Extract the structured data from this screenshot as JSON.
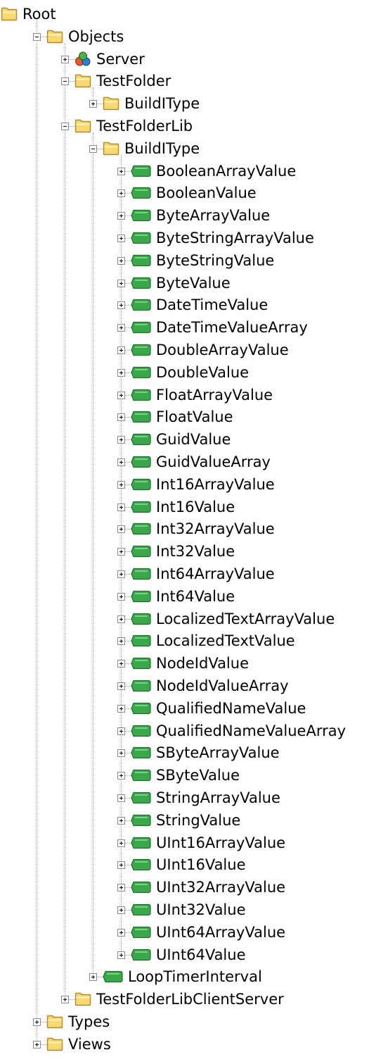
{
  "tree": {
    "label": "Root",
    "icon": "folder-icon",
    "expanded": true,
    "children": [
      {
        "label": "Objects",
        "icon": "folder-icon",
        "expanded": true,
        "children": [
          {
            "label": "Server",
            "icon": "server-icon",
            "expanded": false
          },
          {
            "label": "TestFolder",
            "icon": "folder-icon",
            "expanded": true,
            "children": [
              {
                "label": "BuildIType",
                "icon": "folder-icon",
                "expanded": false
              }
            ]
          },
          {
            "label": "TestFolderLib",
            "icon": "folder-icon",
            "expanded": true,
            "children": [
              {
                "label": "BuildIType",
                "icon": "folder-icon",
                "expanded": true,
                "children": [
                  {
                    "label": "BooleanArrayValue",
                    "icon": "variable-tag-icon",
                    "expanded": false
                  },
                  {
                    "label": "BooleanValue",
                    "icon": "variable-tag-icon",
                    "expanded": false
                  },
                  {
                    "label": "ByteArrayValue",
                    "icon": "variable-tag-icon",
                    "expanded": false
                  },
                  {
                    "label": "ByteStringArrayValue",
                    "icon": "variable-tag-icon",
                    "expanded": false
                  },
                  {
                    "label": "ByteStringValue",
                    "icon": "variable-tag-icon",
                    "expanded": false
                  },
                  {
                    "label": "ByteValue",
                    "icon": "variable-tag-icon",
                    "expanded": false
                  },
                  {
                    "label": "DateTimeValue",
                    "icon": "variable-tag-icon",
                    "expanded": false
                  },
                  {
                    "label": "DateTimeValueArray",
                    "icon": "variable-tag-icon",
                    "expanded": false
                  },
                  {
                    "label": "DoubleArrayValue",
                    "icon": "variable-tag-icon",
                    "expanded": false
                  },
                  {
                    "label": "DoubleValue",
                    "icon": "variable-tag-icon",
                    "expanded": false
                  },
                  {
                    "label": "FloatArrayValue",
                    "icon": "variable-tag-icon",
                    "expanded": false
                  },
                  {
                    "label": "FloatValue",
                    "icon": "variable-tag-icon",
                    "expanded": false
                  },
                  {
                    "label": "GuidValue",
                    "icon": "variable-tag-icon",
                    "expanded": false
                  },
                  {
                    "label": "GuidValueArray",
                    "icon": "variable-tag-icon",
                    "expanded": false
                  },
                  {
                    "label": "Int16ArrayValue",
                    "icon": "variable-tag-icon",
                    "expanded": false
                  },
                  {
                    "label": "Int16Value",
                    "icon": "variable-tag-icon",
                    "expanded": false
                  },
                  {
                    "label": "Int32ArrayValue",
                    "icon": "variable-tag-icon",
                    "expanded": false
                  },
                  {
                    "label": "Int32Value",
                    "icon": "variable-tag-icon",
                    "expanded": false
                  },
                  {
                    "label": "Int64ArrayValue",
                    "icon": "variable-tag-icon",
                    "expanded": false
                  },
                  {
                    "label": "Int64Value",
                    "icon": "variable-tag-icon",
                    "expanded": false
                  },
                  {
                    "label": "LocalizedTextArrayValue",
                    "icon": "variable-tag-icon",
                    "expanded": false
                  },
                  {
                    "label": "LocalizedTextValue",
                    "icon": "variable-tag-icon",
                    "expanded": false
                  },
                  {
                    "label": "NodeIdValue",
                    "icon": "variable-tag-icon",
                    "expanded": false
                  },
                  {
                    "label": "NodeIdValueArray",
                    "icon": "variable-tag-icon",
                    "expanded": false
                  },
                  {
                    "label": "QualifiedNameValue",
                    "icon": "variable-tag-icon",
                    "expanded": false
                  },
                  {
                    "label": "QualifiedNameValueArray",
                    "icon": "variable-tag-icon",
                    "expanded": false
                  },
                  {
                    "label": "SByteArrayValue",
                    "icon": "variable-tag-icon",
                    "expanded": false
                  },
                  {
                    "label": "SByteValue",
                    "icon": "variable-tag-icon",
                    "expanded": false
                  },
                  {
                    "label": "StringArrayValue",
                    "icon": "variable-tag-icon",
                    "expanded": false
                  },
                  {
                    "label": "StringValue",
                    "icon": "variable-tag-icon",
                    "expanded": false
                  },
                  {
                    "label": "UInt16ArrayValue",
                    "icon": "variable-tag-icon",
                    "expanded": false
                  },
                  {
                    "label": "UInt16Value",
                    "icon": "variable-tag-icon",
                    "expanded": false
                  },
                  {
                    "label": "UInt32ArrayValue",
                    "icon": "variable-tag-icon",
                    "expanded": false
                  },
                  {
                    "label": "UInt32Value",
                    "icon": "variable-tag-icon",
                    "expanded": false
                  },
                  {
                    "label": "UInt64ArrayValue",
                    "icon": "variable-tag-icon",
                    "expanded": false
                  },
                  {
                    "label": "UInt64Value",
                    "icon": "variable-tag-icon",
                    "expanded": false
                  }
                ]
              },
              {
                "label": "LoopTimerInterval",
                "icon": "variable-tag-icon",
                "expanded": false
              }
            ]
          },
          {
            "label": "TestFolderLibClientServer",
            "icon": "folder-icon",
            "expanded": false
          }
        ]
      },
      {
        "label": "Types",
        "icon": "folder-icon",
        "expanded": false
      },
      {
        "label": "Views",
        "icon": "folder-icon",
        "expanded": false
      }
    ]
  },
  "colors": {
    "folder_fill": "#f7d872",
    "folder_stroke": "#b08a2a",
    "tag_fill": "#3aa84a",
    "tag_stroke": "#1f6e2a",
    "connector": "#9a9a9a"
  }
}
